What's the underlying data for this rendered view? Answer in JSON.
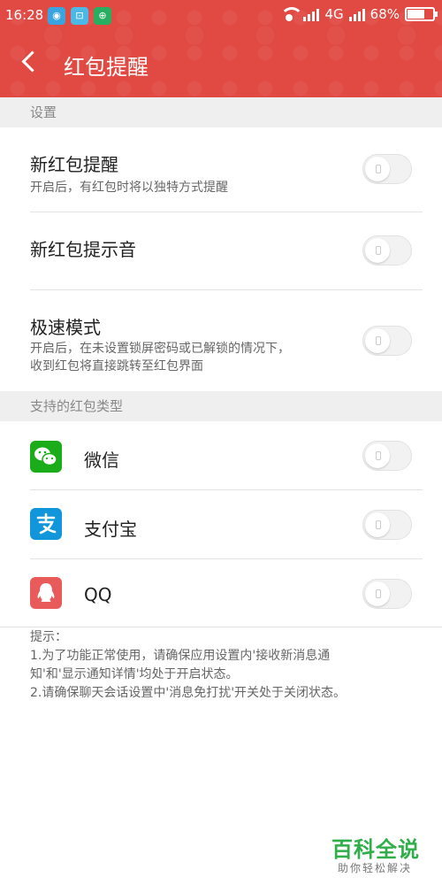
{
  "status_bar": {
    "time": "16:28",
    "network": "4G",
    "battery": "68%",
    "battery_level": 0.68
  },
  "header": {
    "title": "红包提醒"
  },
  "settings_section": {
    "heading": "设置",
    "items": [
      {
        "title": "新红包提醒",
        "subtitle": "开启后，有红包时将以独特方式提醒",
        "enabled": false
      },
      {
        "title": "新红包提示音",
        "enabled": false
      },
      {
        "title": "极速模式",
        "subtitle_line1": "开启后，在未设置锁屏密码或已解锁的情况下，",
        "subtitle_line2": "收到红包将直接跳转至红包界面",
        "enabled": false
      }
    ]
  },
  "types_section": {
    "heading": "支持的红包类型",
    "items": [
      {
        "label": "微信",
        "icon": "wechat-icon",
        "color": "#1aad19",
        "enabled": false
      },
      {
        "label": "支付宝",
        "icon": "alipay-icon",
        "color": "#1296db",
        "enabled": false
      },
      {
        "label": "QQ",
        "icon": "qq-icon",
        "color": "#e95b5b",
        "enabled": false
      }
    ]
  },
  "tip": {
    "heading": "提示：",
    "line1": "1.为了功能正常使用，请确保应用设置内'接收新消息通",
    "line2": "知'和'显示通知详情'均处于开启状态。",
    "line3": "2.请确保聊天会话设置中'消息免打扰'开关处于关闭状态。"
  },
  "watermark": {
    "title": "百科全说",
    "subtitle": "助你轻松解决"
  },
  "colors": {
    "header": "#e04a43",
    "section_bg": "#efefef",
    "watermark": "#2fae4a"
  }
}
